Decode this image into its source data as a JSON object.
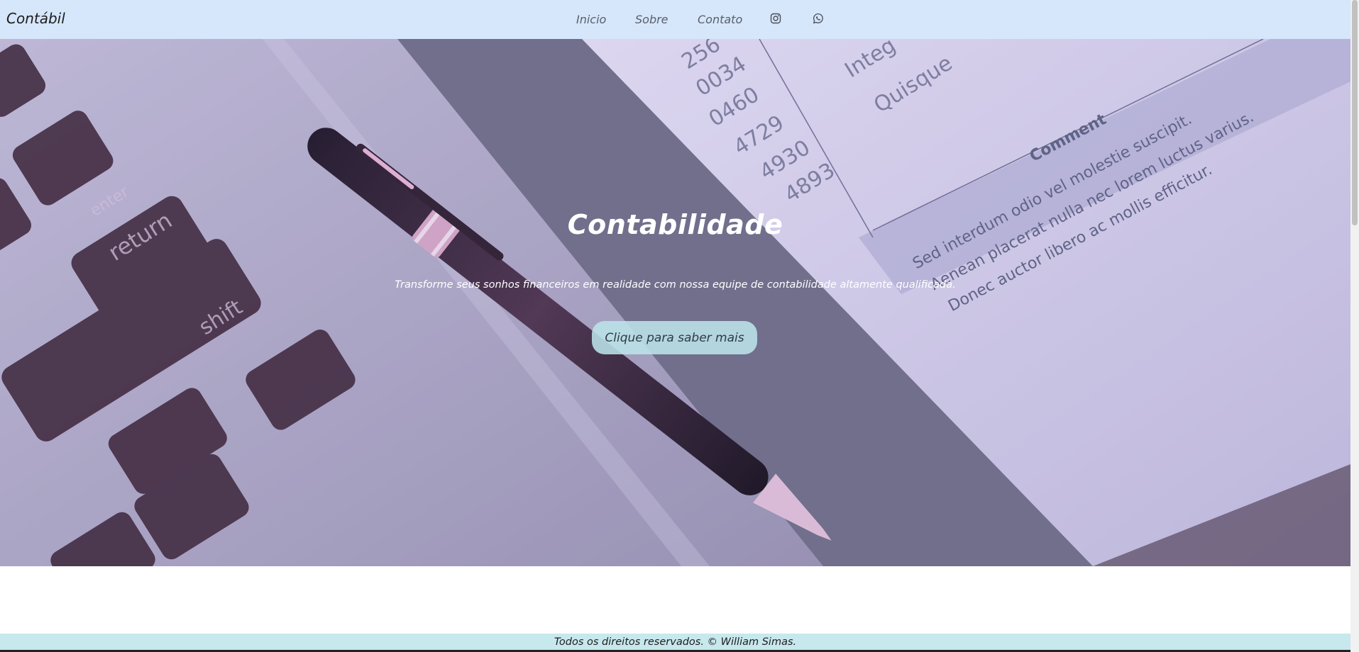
{
  "navbar": {
    "brand": "Contábil",
    "links": [
      {
        "label": "Inicio"
      },
      {
        "label": "Sobre"
      },
      {
        "label": "Contato"
      }
    ],
    "icons": [
      "instagram-icon",
      "whatsapp-icon"
    ]
  },
  "hero": {
    "title": "Contabilidade",
    "subtitle": "Transforme seus sonhos financeiros em realidade com nossa equipe de contabilidade altamente qualificada.",
    "button_label": "Clique para saber mais",
    "photo_text": {
      "numbers": [
        "256",
        "0034",
        "0460",
        "4729",
        "4930",
        "4893"
      ],
      "words": [
        "Integ",
        "Quisque"
      ],
      "comment_header": "Comment",
      "comment_lines": [
        "Sed interdum odio vel molestie suscipit.",
        "Aenean placerat nulla nec lorem luctus varius.",
        "Donec auctor libero ac mollis efficitur."
      ],
      "keys": [
        "enter",
        "return",
        "shift"
      ]
    }
  },
  "footer": {
    "text": "Todos os direitos reservados. © William Simas."
  },
  "colors": {
    "navbar_bg": "#d6e6fb",
    "footer_bg": "#c7e8ec",
    "button_bg": "#bbe4e9"
  }
}
